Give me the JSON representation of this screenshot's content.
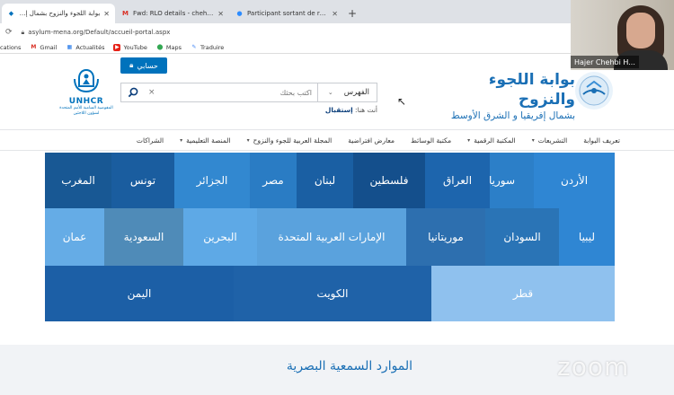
{
  "browser": {
    "tabs": [
      {
        "title": "بوابة اللجوء والنزوح بشمال إفريقيا والشرق الأوسط",
        "icon": "unhcr-favicon",
        "active": true
      },
      {
        "title": "Fwd: RLO details - chehbi.hajer@",
        "icon": "gmail-icon",
        "active": false
      },
      {
        "title": "Participant sortant de réunion -",
        "icon": "zoom-icon",
        "active": false
      }
    ],
    "url": "asylum-mena.org/Default/accueil-portal.aspx",
    "bookmarks": [
      {
        "label": "cations",
        "icon": ""
      },
      {
        "label": "Gmail",
        "icon": "gmail-icon"
      },
      {
        "label": "Actualités",
        "icon": "news-icon"
      },
      {
        "label": "YouTube",
        "icon": "youtube-icon"
      },
      {
        "label": "Maps",
        "icon": "maps-icon"
      },
      {
        "label": "Traduire",
        "icon": "translate-icon"
      }
    ]
  },
  "header": {
    "account_button": "حسابي",
    "unhcr_name": "UNHCR",
    "unhcr_sub_1": "المفوضية السامية للأمم المتحدة",
    "unhcr_sub_2": "لشؤون اللاجئين",
    "search_scope": "الفهرس",
    "search_placeholder": "اكتب بحثك",
    "logged_in_prefix": "أنت هنا:",
    "logged_in_link": "إستقبال",
    "brand_title": "بوابة اللجوء والنزوح",
    "brand_subtitle": "بشمال إفريقيا و الشرق الأوسط"
  },
  "nav": {
    "items": [
      {
        "label": "تعريف البوابة",
        "dropdown": false
      },
      {
        "label": "التشريعات",
        "dropdown": true
      },
      {
        "label": "المكتبة الرقمية",
        "dropdown": true
      },
      {
        "label": "مكتبة الوسائط",
        "dropdown": false
      },
      {
        "label": "معارض افتراضية",
        "dropdown": false
      },
      {
        "label": "المجلة العربية للجوء والنزوح",
        "dropdown": true
      },
      {
        "label": "المنصة التعليمية",
        "dropdown": true
      },
      {
        "label": "الشراكات",
        "dropdown": false
      }
    ]
  },
  "countries": {
    "tiles": [
      {
        "label": "الأردن",
        "color": "#2f86d3"
      },
      {
        "label": "سوريا",
        "color": "#2c7fc8"
      },
      {
        "label": "العراق",
        "color": "#1d65ad"
      },
      {
        "label": "فلسطين",
        "color": "#144f8c"
      },
      {
        "label": "لبنان",
        "color": "#1a5fa3"
      },
      {
        "label": "مصر",
        "color": "#2a7cc4"
      },
      {
        "label": "الجزائر",
        "color": "#3288d0"
      },
      {
        "label": "تونس",
        "color": "#1a5d9f"
      },
      {
        "label": "المغرب",
        "color": "#185894"
      },
      {
        "label": "ليبيا",
        "color": "#2f86d3"
      },
      {
        "label": "السودان",
        "color": "#2a74b6"
      },
      {
        "label": "موريتانيا",
        "color": "#2d6faf"
      },
      {
        "label": "الإمارات العربية المتحدة",
        "color": "#5aa2dd"
      },
      {
        "label": "البحرين",
        "color": "#5ea9e6"
      },
      {
        "label": "السعودية",
        "color": "#4f8bb8"
      },
      {
        "label": "عمان",
        "color": "#65ace6"
      },
      {
        "label": "قطر",
        "color": "#8fc1ee"
      },
      {
        "label": "الكويت",
        "color": "#1f62a8"
      },
      {
        "label": "اليمن",
        "color": "#1c5fa6"
      }
    ]
  },
  "resources": {
    "title": "الموارد السمعية البصرية"
  },
  "zoom": {
    "participant_name": "Hajer Chehbi H...",
    "watermark": "zoom"
  }
}
